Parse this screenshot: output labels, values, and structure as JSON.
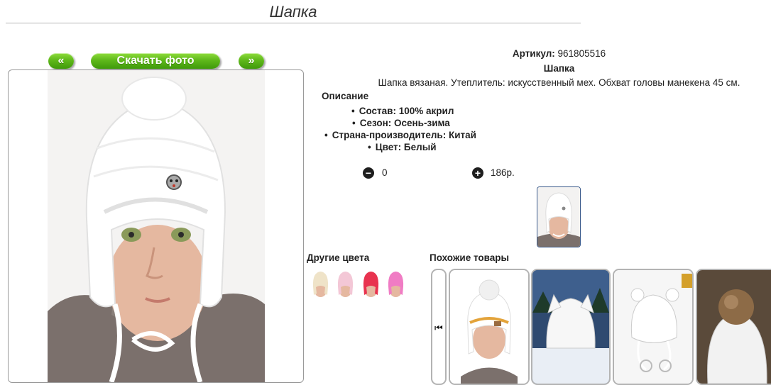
{
  "page": {
    "title": "Шапка"
  },
  "gallery": {
    "prev_label": "«",
    "download_label": "Скачать фото",
    "next_label": "»"
  },
  "product": {
    "sku_label": "Артикул:",
    "sku_value": "961805516",
    "name": "Шапка",
    "description": "Шапка вязаная. Утеплитель: искусственный мех. Обхват головы манекена 45 см.",
    "description_header": "Описание",
    "specs": [
      "Состав: 100% акрил",
      "Сезон: Осень-зима",
      "Страна-производитель: Китай",
      "Цвет: Белый"
    ],
    "quantity": "0",
    "price": "186р."
  },
  "other_colors": {
    "header": "Другие цвета",
    "swatches": [
      {
        "color": "#efe3c8",
        "accent": "#e9c98f"
      },
      {
        "color": "#f3c7d6",
        "accent": "#e89bb4"
      },
      {
        "color": "#e8334f",
        "accent": "#b81c33"
      },
      {
        "color": "#f07cc4",
        "accent": "#d94fa6"
      }
    ]
  },
  "similar": {
    "header": "Похожие товары"
  },
  "colors": {
    "button_green": "#5fb81b",
    "thumb_border": "#3a5a8c"
  }
}
